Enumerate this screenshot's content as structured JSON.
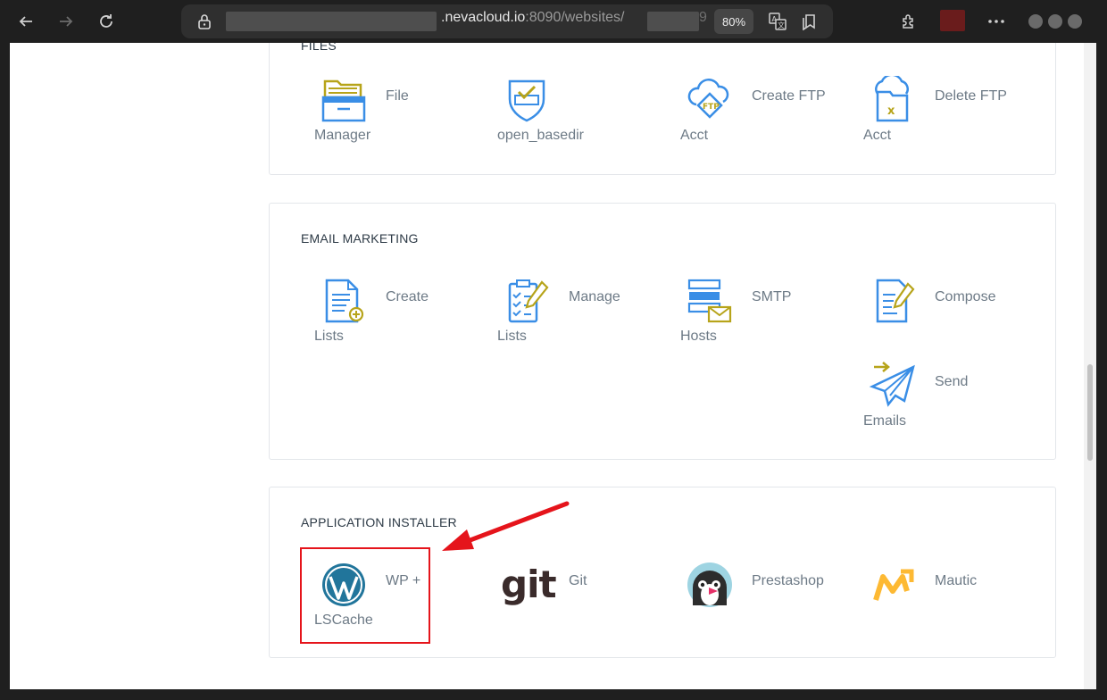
{
  "browser": {
    "url_host": ".nevacloud.io",
    "url_rest": ":8090/websites/",
    "url_tail": "9",
    "zoom": "80%",
    "icons": [
      "back-icon",
      "forward-icon",
      "reload-icon",
      "lock-icon",
      "translate-icon",
      "bookmark-icon",
      "extensions-icon",
      "more-icon"
    ]
  },
  "sections": {
    "files": {
      "title": "FILES",
      "items": [
        {
          "l1": "File",
          "l2": "Manager",
          "icon": "folder-cabinet-icon"
        },
        {
          "l1": "",
          "l2": "open_basedir",
          "icon": "shield-check-icon"
        },
        {
          "l1": "Create FTP",
          "l2": "Acct",
          "icon": "ftp-cloud-icon"
        },
        {
          "l1": "Delete FTP",
          "l2": "Acct",
          "icon": "delete-ftp-icon"
        }
      ]
    },
    "email_marketing": {
      "title": "EMAIL MARKETING",
      "items": [
        {
          "l1": "Create",
          "l2": "Lists",
          "icon": "create-list-icon"
        },
        {
          "l1": "Manage",
          "l2": "Lists",
          "icon": "manage-list-icon"
        },
        {
          "l1": "SMTP",
          "l2": "Hosts",
          "icon": "smtp-hosts-icon"
        },
        {
          "l1": "Compose",
          "l2": "",
          "icon": "compose-icon"
        },
        {
          "l1": "Send",
          "l2": "Emails",
          "icon": "paper-plane-icon"
        }
      ]
    },
    "app_installer": {
      "title": "APPLICATION INSTALLER",
      "items": [
        {
          "l1": "WP +",
          "l2": "LSCache",
          "icon": "wordpress-icon"
        },
        {
          "l1": "Git",
          "l2": "",
          "icon": "git-logo-icon"
        },
        {
          "l1": "Prestashop",
          "l2": "",
          "icon": "prestashop-icon"
        },
        {
          "l1": "Mautic",
          "l2": "",
          "icon": "mautic-icon"
        }
      ]
    }
  },
  "git_logo_text": "git",
  "colors": {
    "accent_blue": "#3a8ee6",
    "accent_olive": "#b7a41a",
    "highlight_red": "#e5141b",
    "label_gray": "#6d7a86"
  }
}
